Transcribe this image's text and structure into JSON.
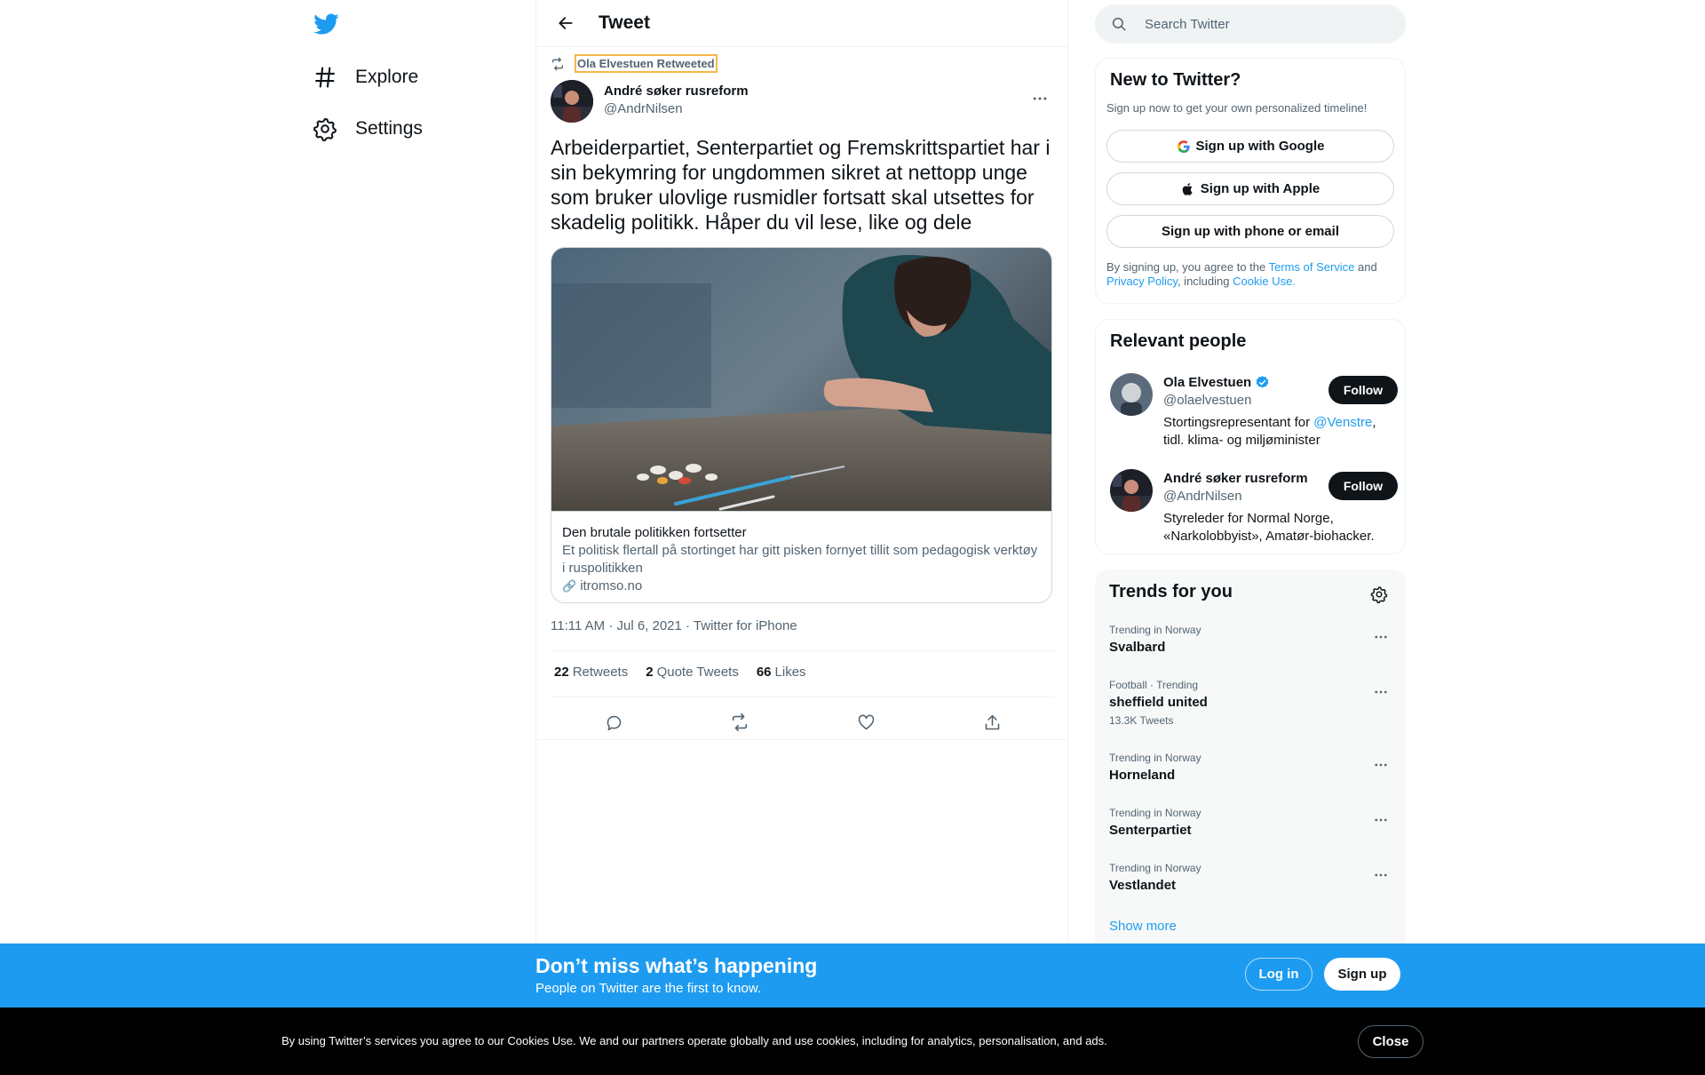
{
  "nav": {
    "logo_icon": "twitter-bird-icon",
    "items": [
      {
        "label": "Explore",
        "icon": "hashtag-icon"
      },
      {
        "label": "Settings",
        "icon": "gear-icon"
      }
    ]
  },
  "header": {
    "title": "Tweet",
    "back_icon": "arrow-left-icon"
  },
  "tweet": {
    "retweeted_by": "Ola Elvestuen Retweeted",
    "author_name": "André søker rusreform",
    "author_handle": "@AndrNilsen",
    "text": "Arbeiderpartiet, Senterpartiet og Fremskrittspartiet har i sin bekymring for ungdommen sikret at nettopp unge som bruker ulovlige rusmidler fortsatt skal utsettes for skadelig politikk. Håper du vil lese, like og dele",
    "card": {
      "title": "Den brutale politikken fortsetter",
      "description": "Et politisk flertall på stortinget har gitt pisken fornyet tillit som pedagogisk verktøy i ruspolitikken",
      "domain": "itromso.no"
    },
    "timestamp": "11:11 AM · Jul 6, 2021 · Twitter for iPhone",
    "stats": [
      {
        "num": "22",
        "label": "Retweets"
      },
      {
        "num": "2",
        "label": "Quote Tweets"
      },
      {
        "num": "66",
        "label": "Likes"
      }
    ]
  },
  "search": {
    "placeholder": "Search Twitter"
  },
  "signup_panel": {
    "title": "New to Twitter?",
    "subtitle": "Sign up now to get your own personalized timeline!",
    "google": "Sign up with Google",
    "apple": "Sign up with Apple",
    "phone": "Sign up with phone or email",
    "legal_1": "By signing up, you agree to the ",
    "terms": "Terms of Service",
    "legal_2": " and ",
    "privacy": "Privacy Policy",
    "legal_3": ", including ",
    "cookie": "Cookie Use."
  },
  "people": {
    "title": "Relevant people",
    "list": [
      {
        "name": "Ola Elvestuen",
        "handle": "@olaelvestuen",
        "verified": true,
        "bio_1": "Stortingsrepresentant for ",
        "bio_mention": "@Venstre",
        "bio_2": ", tidl. klima- og miljøminister",
        "follow": "Follow"
      },
      {
        "name": "André søker rusreform",
        "handle": "@AndrNilsen",
        "verified": false,
        "bio": "Styreleder for Normal Norge, «Narkolobbyist», Amatør-biohacker.",
        "follow": "Follow"
      }
    ]
  },
  "trends": {
    "title": "Trends for you",
    "items": [
      {
        "context": "Trending in Norway",
        "name": "Svalbard",
        "count": ""
      },
      {
        "context": "Football · Trending",
        "name": "sheffield united",
        "count": "13.3K Tweets"
      },
      {
        "context": "Trending in Norway",
        "name": "Horneland",
        "count": ""
      },
      {
        "context": "Trending in Norway",
        "name": "Senterpartiet",
        "count": ""
      },
      {
        "context": "Trending in Norway",
        "name": "Vestlandet",
        "count": ""
      }
    ],
    "show_more": "Show more"
  },
  "bottom_bar": {
    "title": "Don’t miss what’s happening",
    "subtitle": "People on Twitter are the first to know.",
    "login": "Log in",
    "signup": "Sign up"
  },
  "cookie_bar": {
    "text": "By using Twitter’s services you agree to our Cookies Use. We and our partners operate globally and use cookies, including for analytics, personalisation, and ads.",
    "close": "Close"
  },
  "colors": {
    "accent": "#1d9bf0",
    "text_primary": "#0f1419",
    "text_secondary": "#536471",
    "border": "#eff3f4"
  }
}
